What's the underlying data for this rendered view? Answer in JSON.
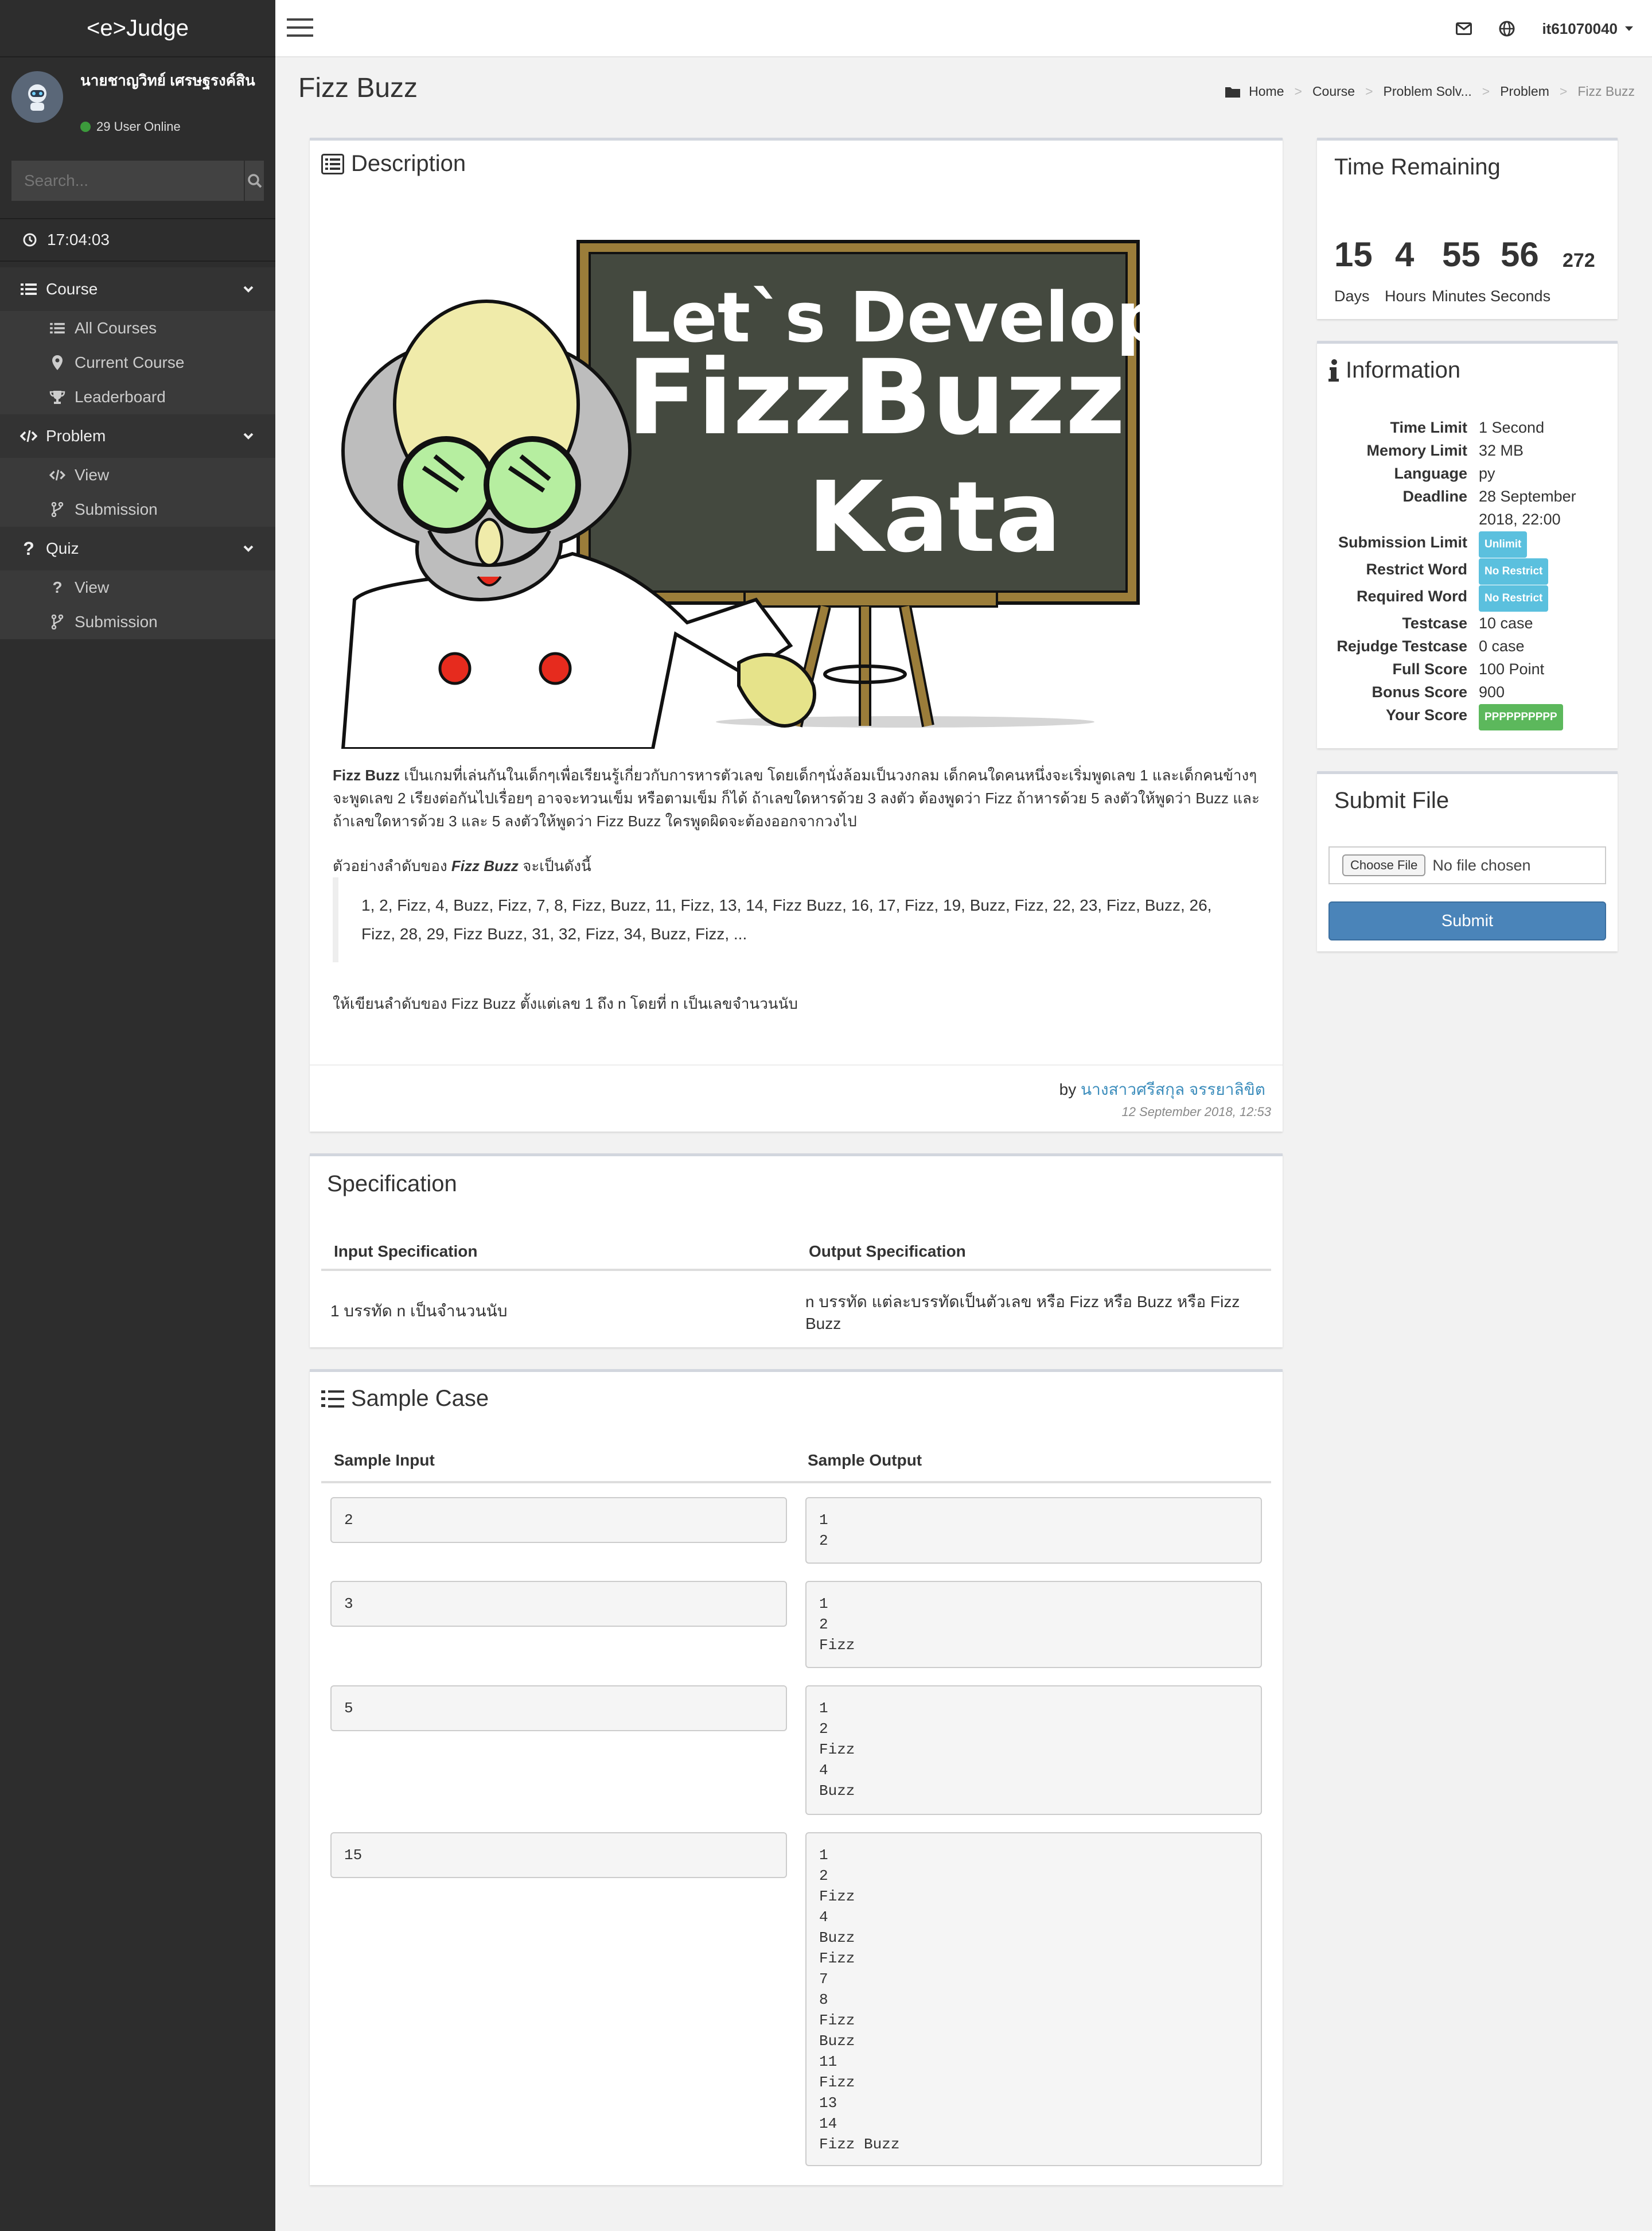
{
  "app": {
    "logo": "<e>Judge"
  },
  "user": {
    "name": "นายชาญวิทย์ เศรษฐรงค์สิน",
    "online_text": "29 User Online",
    "username": "it61070040"
  },
  "search": {
    "placeholder": "Search..."
  },
  "clock": "17:04:03",
  "sidebar": {
    "course": {
      "label": "Course",
      "items": [
        "All Courses",
        "Current Course",
        "Leaderboard"
      ]
    },
    "problem": {
      "label": "Problem",
      "items": [
        "View",
        "Submission"
      ]
    },
    "quiz": {
      "label": "Quiz",
      "items": [
        "View",
        "Submission"
      ]
    }
  },
  "page": {
    "title": "Fizz Buzz"
  },
  "breadcrumb": [
    "Home",
    "Course",
    "Problem Solv...",
    "Problem",
    "Fizz Buzz"
  ],
  "description": {
    "title": "Description",
    "image_lines": [
      "Let`s Develop",
      "FizzBuzz",
      "Kata"
    ],
    "para_bold": "Fizz Buzz",
    "para": " เป็นเกมที่เล่นกันในเด็กๆเพื่อเรียนรู้เกี่ยวกับการหารตัวเลข โดยเด็กๆนั่งล้อมเป็นวงกลม เด็กคนใดคนหนึ่งจะเริ่มพูดเลข 1 และเด็กคนข้างๆจะพูดเลข 2 เรียงต่อกันไปเรื่อยๆ อาจจะทวนเข็ม หรือตามเข็ม ก็ได้ ถ้าเลขใดหารด้วย 3 ลงตัว ต้องพูดว่า Fizz ถ้าหารด้วย 5 ลงตัวให้พูดว่า Buzz และถ้าเลขใดหารด้วย 3 และ 5 ลงตัวให้พูดว่า Fizz Buzz ใครพูดผิดจะต้องออกจากวงไป",
    "example_pre": "ตัวอย่างลำดับของ ",
    "example_bold": "Fizz Buzz",
    "example_post": " จะเป็นดังนี้",
    "sequence": "1, 2, Fizz, 4, Buzz, Fizz, 7, 8, Fizz, Buzz, 11, Fizz, 13, 14, Fizz Buzz, 16, 17, Fizz, 19, Buzz, Fizz, 22, 23, Fizz, Buzz, 26, Fizz, 28, 29, Fizz Buzz, 31, 32, Fizz, 34, Buzz, Fizz, ...",
    "task": "ให้เขียนลำดับของ Fizz Buzz ตั้งแต่เลข 1 ถึง n โดยที่ n เป็นเลขจำนวนนับ",
    "by_label": "by ",
    "author": "นางสาวศรีสกุล จรรยาลิขิต",
    "date": "12 September 2018, 12:53"
  },
  "specification": {
    "title": "Specification",
    "input_header": "Input Specification",
    "output_header": "Output Specification",
    "input": "1 บรรทัด n เป็นจำนวนนับ",
    "output": "n บรรทัด แต่ละบรรทัดเป็นตัวเลข หรือ Fizz หรือ Buzz หรือ Fizz Buzz"
  },
  "samples": {
    "title": "Sample Case",
    "input_header": "Sample Input",
    "output_header": "Sample Output",
    "cases": [
      {
        "input": "2",
        "output": "1\n2"
      },
      {
        "input": "3",
        "output": "1\n2\nFizz"
      },
      {
        "input": "5",
        "output": "1\n2\nFizz\n4\nBuzz"
      },
      {
        "input": "15",
        "output": "1\n2\nFizz\n4\nBuzz\nFizz\n7\n8\nFizz\nBuzz\n11\nFizz\n13\n14\nFizz Buzz"
      }
    ]
  },
  "time_remaining": {
    "title": "Time Remaining",
    "days": "15",
    "hours": "4",
    "minutes": "55",
    "seconds": "56",
    "ms": "272",
    "days_label": "Days",
    "hours_label": "Hours",
    "minutes_label": "Minutes",
    "seconds_label": "Seconds"
  },
  "information": {
    "title": "Information",
    "rows": [
      {
        "k": "Time Limit",
        "v": "1 Second"
      },
      {
        "k": "Memory Limit",
        "v": "32 MB"
      },
      {
        "k": "Language",
        "v": "py"
      },
      {
        "k": "Deadline",
        "v": "28 September 2018, 22:00"
      },
      {
        "k": "Submission Limit",
        "badge": "Unlimit"
      },
      {
        "k": "Restrict Word",
        "badge": "No Restrict"
      },
      {
        "k": "Required Word",
        "badge": "No Restrict"
      },
      {
        "k": "Testcase",
        "v": "10 case"
      },
      {
        "k": "Rejudge Testcase",
        "v": "0 case"
      },
      {
        "k": "Full Score",
        "v": "100 Point"
      },
      {
        "k": "Bonus Score",
        "v": "900"
      },
      {
        "k": "Your Score",
        "badge": "PPPPPPPPPP"
      }
    ]
  },
  "submit": {
    "title": "Submit File",
    "choose_label": "Choose File",
    "no_file": "No file chosen",
    "button": "Submit"
  },
  "colors": {
    "sidebar_bg": "#2d2d2d",
    "info_badge": "#5bc0de",
    "success_badge": "#5cb85c",
    "submit_btn": "#4a84b9",
    "link": "#3c8dbc"
  }
}
